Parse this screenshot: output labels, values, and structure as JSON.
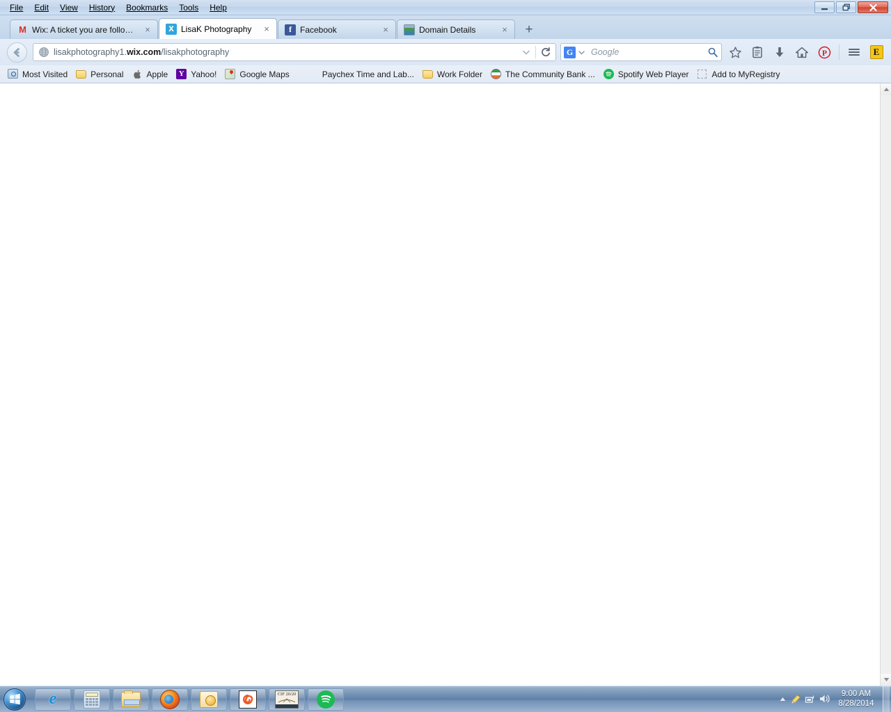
{
  "window": {
    "menus": [
      "File",
      "Edit",
      "View",
      "History",
      "Bookmarks",
      "Tools",
      "Help"
    ],
    "controls": {
      "minimize": "Minimize",
      "restore": "Restore",
      "close": "Close"
    }
  },
  "tabs": [
    {
      "label": "Wix: A ticket you are follow...",
      "icon": "gmail-icon",
      "active": false,
      "close": "×"
    },
    {
      "label": "LisaK Photography",
      "icon": "wix-icon",
      "active": true,
      "close": "×"
    },
    {
      "label": "Facebook",
      "icon": "facebook-icon",
      "active": false,
      "close": "×"
    },
    {
      "label": "Domain Details",
      "icon": "globe-icon",
      "active": false,
      "close": "×"
    }
  ],
  "newtab_label": "+",
  "navbar": {
    "back_icon": "back-arrow-icon",
    "url_prefix": "lisakphotography1.",
    "url_domain": "wix.com",
    "url_suffix": "/lisakphotography",
    "dropdown_icon": "chevron-down-icon",
    "reload_icon": "reload-icon",
    "search": {
      "engine": "Google",
      "engine_initial": "G",
      "placeholder": "Google",
      "value": "",
      "search_icon": "magnifier-icon"
    },
    "tools": [
      {
        "name": "bookmark-star-icon",
        "label": "Bookmark this page"
      },
      {
        "name": "reading-list-icon",
        "label": "Reading list"
      },
      {
        "name": "downloads-icon",
        "label": "Downloads"
      },
      {
        "name": "home-icon",
        "label": "Home"
      },
      {
        "name": "pinterest-icon",
        "label": "Pinterest",
        "color": "#cb2027",
        "glyph": "P"
      },
      {
        "name": "menu-hamburger-icon",
        "label": "Open menu"
      },
      {
        "name": "extension-icon",
        "label": "Extension",
        "glyph": "E"
      }
    ]
  },
  "bookmarks": [
    {
      "label": "Most Visited",
      "icon": "most-visited-icon"
    },
    {
      "label": "Personal",
      "icon": "folder-icon"
    },
    {
      "label": "Apple",
      "icon": "apple-icon"
    },
    {
      "label": "Yahoo!",
      "icon": "yahoo-icon",
      "glyph": "Y"
    },
    {
      "label": "Google Maps",
      "icon": "google-maps-icon"
    },
    {
      "label": "Paychex Time and Lab...",
      "icon": "blank-icon"
    },
    {
      "label": "Work Folder",
      "icon": "folder-icon"
    },
    {
      "label": "The Community Bank ...",
      "icon": "community-bank-icon"
    },
    {
      "label": "Spotify Web Player",
      "icon": "spotify-icon"
    },
    {
      "label": "Add to MyRegistry",
      "icon": "myregistry-icon"
    }
  ],
  "content": {
    "body_text": "",
    "scroll": {
      "up_icon": "scroll-up-arrow-icon",
      "down_icon": "scroll-down-arrow-icon"
    }
  },
  "taskbar": {
    "start": {
      "name": "start-orb",
      "label": "Start"
    },
    "items": [
      {
        "name": "taskbar-internet-explorer",
        "label": "Internet Explorer",
        "glyph": "e"
      },
      {
        "name": "taskbar-calculator",
        "label": "Calculator"
      },
      {
        "name": "taskbar-file-explorer",
        "label": "Windows Explorer"
      },
      {
        "name": "taskbar-firefox",
        "label": "Mozilla Firefox"
      },
      {
        "name": "taskbar-outlook",
        "label": "Microsoft Outlook"
      },
      {
        "name": "taskbar-spiral-app",
        "label": "Application"
      },
      {
        "name": "taskbar-cif-2020",
        "label": "CIF 20/20",
        "glyph": "CIF 20/20"
      },
      {
        "name": "taskbar-spotify",
        "label": "Spotify"
      }
    ],
    "tray": {
      "show_hidden_icon": "show-hidden-icons-arrow",
      "icons": [
        {
          "name": "flag-pen-icon",
          "label": "Action Center"
        },
        {
          "name": "network-icon",
          "label": "Network"
        },
        {
          "name": "volume-icon",
          "label": "Volume"
        }
      ],
      "time": "9:00 AM",
      "date": "8/28/2014"
    },
    "show_desktop": "Show desktop"
  },
  "colors": {
    "accent": "#4285f4",
    "close_red": "#cf4532",
    "chrome_blue": "#c2d5ea",
    "taskbar_blue": "#5e7fa6",
    "spotify_green": "#1db954",
    "pinterest_red": "#cb2027"
  }
}
